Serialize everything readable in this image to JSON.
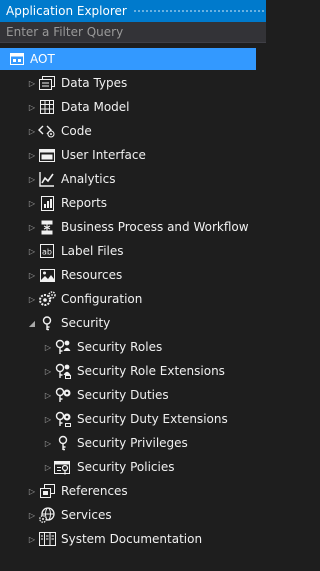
{
  "panel": {
    "title": "Application Explorer"
  },
  "filter": {
    "placeholder": "Enter a Filter Query",
    "value": ""
  },
  "root": {
    "label": "AOT"
  },
  "nodes": [
    {
      "label": "Data Types",
      "icon": "data-types-icon",
      "state": "collapsed"
    },
    {
      "label": "Data Model",
      "icon": "data-model-icon",
      "state": "collapsed"
    },
    {
      "label": "Code",
      "icon": "code-icon",
      "state": "collapsed"
    },
    {
      "label": "User Interface",
      "icon": "user-interface-icon",
      "state": "collapsed"
    },
    {
      "label": "Analytics",
      "icon": "analytics-icon",
      "state": "collapsed"
    },
    {
      "label": "Reports",
      "icon": "reports-icon",
      "state": "collapsed"
    },
    {
      "label": "Business Process and Workflow",
      "icon": "workflow-icon",
      "state": "collapsed"
    },
    {
      "label": "Label Files",
      "icon": "label-files-icon",
      "state": "collapsed"
    },
    {
      "label": "Resources",
      "icon": "resources-icon",
      "state": "collapsed"
    },
    {
      "label": "Configuration",
      "icon": "configuration-icon",
      "state": "collapsed"
    },
    {
      "label": "Security",
      "icon": "security-icon",
      "state": "expanded"
    },
    {
      "label": "References",
      "icon": "references-icon",
      "state": "collapsed"
    },
    {
      "label": "Services",
      "icon": "services-icon",
      "state": "collapsed"
    },
    {
      "label": "System Documentation",
      "icon": "system-documentation-icon",
      "state": "collapsed"
    }
  ],
  "security_children": [
    {
      "label": "Security Roles",
      "icon": "security-roles-icon"
    },
    {
      "label": "Security Role Extensions",
      "icon": "security-role-extensions-icon"
    },
    {
      "label": "Security Duties",
      "icon": "security-duties-icon"
    },
    {
      "label": "Security Duty Extensions",
      "icon": "security-duty-extensions-icon"
    },
    {
      "label": "Security Privileges",
      "icon": "security-privileges-icon"
    },
    {
      "label": "Security Policies",
      "icon": "security-policies-icon"
    }
  ],
  "colors": {
    "background": "#1e1e1e",
    "title_bar": "#007acc",
    "selection": "#3399ff",
    "text": "#f1f1f1",
    "caret": "#a9a9a9"
  }
}
